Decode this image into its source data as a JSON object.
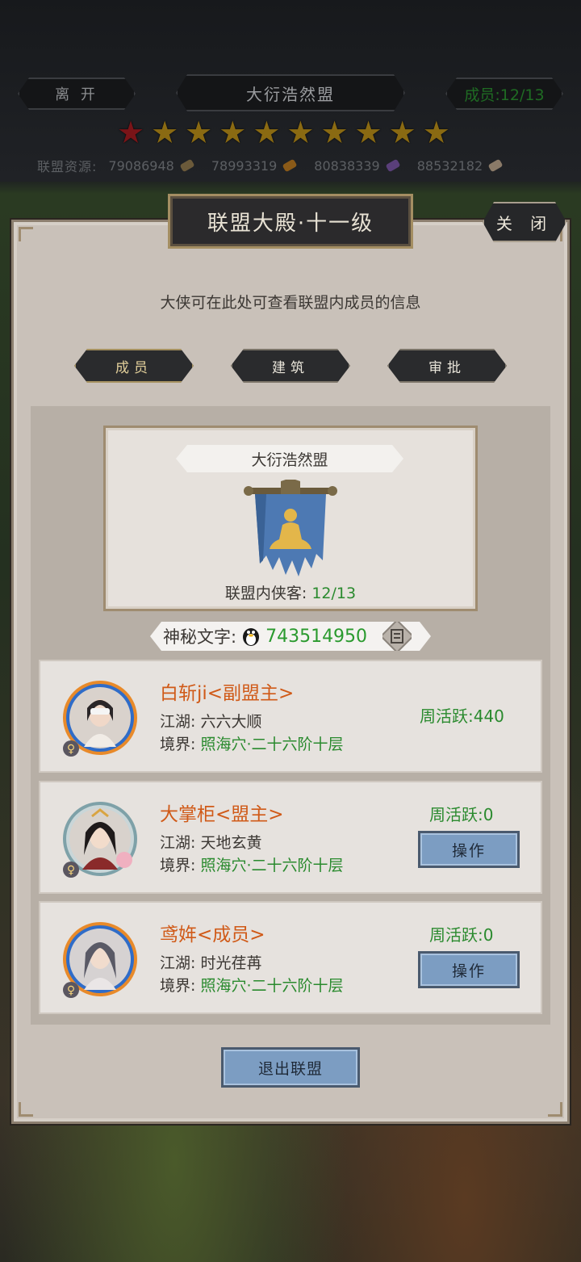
{
  "top": {
    "leave_label": "离 开",
    "alliance_name": "大衍浩然盟",
    "member_count": "成员:12/13",
    "stars_total": 10,
    "stars_red": 1,
    "resources_label": "联盟资源:",
    "resources": [
      {
        "value": "79086948",
        "icon": "scroll-icon",
        "color": "#6b5a3a"
      },
      {
        "value": "78993319",
        "icon": "wood-icon",
        "color": "#8a5a18"
      },
      {
        "value": "80838339",
        "icon": "crystal-icon",
        "color": "#5a3f7a"
      },
      {
        "value": "88532182",
        "icon": "ingot-icon",
        "color": "#8a7a68"
      }
    ]
  },
  "panel": {
    "title": "联盟大殿·十一级",
    "close_label": "关 闭",
    "description": "大侠可在此处可查看联盟内成员的信息",
    "tabs": [
      {
        "label": "成员",
        "active": true
      },
      {
        "label": "建筑",
        "active": false
      },
      {
        "label": "审批",
        "active": false
      }
    ],
    "card": {
      "alliance_name": "大衍浩然盟",
      "guests_label": "联盟内侠客:",
      "guests_value": "12/13"
    },
    "mystery": {
      "label": "神秘文字:",
      "value": "743514950"
    },
    "members": [
      {
        "name": "白斩ji<副盟主>",
        "jianghu_label": "江湖:",
        "jianghu": "六六大顺",
        "realm_label": "境界:",
        "realm": "照海穴·二十六阶十层",
        "activity": "周活跃:440",
        "show_op": false
      },
      {
        "name": "大掌柜<盟主>",
        "jianghu_label": "江湖:",
        "jianghu": "天地玄黄",
        "realm_label": "境界:",
        "realm": "照海穴·二十六阶十层",
        "activity": "周活跃:0",
        "show_op": true,
        "op_label": "操作"
      },
      {
        "name": "鸢姩<成员>",
        "jianghu_label": "江湖:",
        "jianghu": "时光荏苒",
        "realm_label": "境界:",
        "realm": "照海穴·二十六阶十层",
        "activity": "周活跃:0",
        "show_op": true,
        "op_label": "操作"
      }
    ],
    "quit_label": "退出联盟"
  },
  "colors": {
    "accent_orange": "#d05a18",
    "green": "#2a8a2e",
    "button_blue": "#7c9dc2"
  }
}
